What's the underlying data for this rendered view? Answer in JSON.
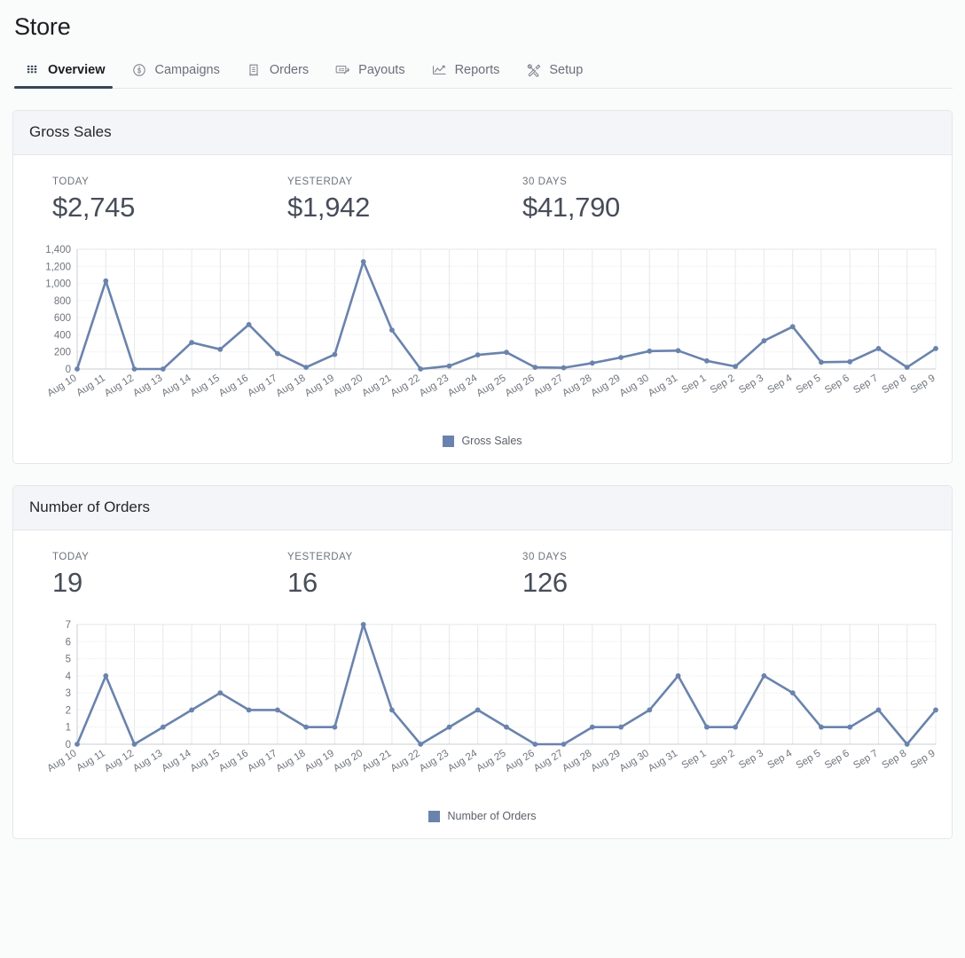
{
  "header": {
    "title": "Store",
    "tabs": [
      {
        "label": "Overview",
        "icon": "grid-dots-icon",
        "active": true
      },
      {
        "label": "Campaigns",
        "icon": "dollar-circle-icon",
        "active": false
      },
      {
        "label": "Orders",
        "icon": "receipt-icon",
        "active": false
      },
      {
        "label": "Payouts",
        "icon": "check-payment-icon",
        "active": false
      },
      {
        "label": "Reports",
        "icon": "line-chart-icon",
        "active": false
      },
      {
        "label": "Setup",
        "icon": "tools-icon",
        "active": false
      }
    ]
  },
  "colors": {
    "series": "#6a83ad",
    "accent": "#3a4457",
    "card_header_bg": "#f3f5f8",
    "border": "#e4e6ea",
    "page_bg": "#fafbfb"
  },
  "cards": [
    {
      "title": "Gross Sales",
      "stats": [
        {
          "label": "TODAY",
          "value": "$2,745"
        },
        {
          "label": "YESTERDAY",
          "value": "$1,942"
        },
        {
          "label": "30 DAYS",
          "value": "$41,790"
        }
      ],
      "legend": "Gross Sales"
    },
    {
      "title": "Number of Orders",
      "stats": [
        {
          "label": "TODAY",
          "value": "19"
        },
        {
          "label": "YESTERDAY",
          "value": "16"
        },
        {
          "label": "30 DAYS",
          "value": "126"
        }
      ],
      "legend": "Number of Orders"
    }
  ],
  "chart_data": [
    {
      "type": "line",
      "title": "Gross Sales",
      "xlabel": "",
      "ylabel": "",
      "grid": true,
      "legend": [
        "Gross Sales"
      ],
      "legend_position": "bottom",
      "ylim": [
        0,
        1400
      ],
      "yticks": [
        0,
        200,
        400,
        600,
        800,
        1000,
        1200,
        1400
      ],
      "ytick_labels": [
        "0",
        "200",
        "400",
        "600",
        "800",
        "1,000",
        "1,200",
        "1,400"
      ],
      "categories": [
        "Aug 10",
        "Aug 11",
        "Aug 12",
        "Aug 13",
        "Aug 14",
        "Aug 15",
        "Aug 16",
        "Aug 17",
        "Aug 18",
        "Aug 19",
        "Aug 20",
        "Aug 21",
        "Aug 22",
        "Aug 23",
        "Aug 24",
        "Aug 25",
        "Aug 26",
        "Aug 27",
        "Aug 28",
        "Aug 29",
        "Aug 30",
        "Aug 31",
        "Sep 1",
        "Sep 2",
        "Sep 3",
        "Sep 4",
        "Sep 5",
        "Sep 6",
        "Sep 7",
        "Sep 8",
        "Sep 9"
      ],
      "series": [
        {
          "name": "Gross Sales",
          "values": [
            0,
            1030,
            0,
            0,
            310,
            230,
            520,
            180,
            20,
            170,
            1255,
            455,
            0,
            35,
            165,
            195,
            20,
            15,
            70,
            135,
            210,
            215,
            95,
            30,
            330,
            495,
            80,
            85,
            240,
            20,
            240
          ]
        }
      ]
    },
    {
      "type": "line",
      "title": "Number of Orders",
      "xlabel": "",
      "ylabel": "",
      "grid": true,
      "legend": [
        "Number of Orders"
      ],
      "legend_position": "bottom",
      "ylim": [
        0,
        7
      ],
      "yticks": [
        0,
        1,
        2,
        3,
        4,
        5,
        6,
        7
      ],
      "ytick_labels": [
        "0",
        "1",
        "2",
        "3",
        "4",
        "5",
        "6",
        "7"
      ],
      "categories": [
        "Aug 10",
        "Aug 11",
        "Aug 12",
        "Aug 13",
        "Aug 14",
        "Aug 15",
        "Aug 16",
        "Aug 17",
        "Aug 18",
        "Aug 19",
        "Aug 20",
        "Aug 21",
        "Aug 22",
        "Aug 23",
        "Aug 24",
        "Aug 25",
        "Aug 26",
        "Aug 27",
        "Aug 28",
        "Aug 29",
        "Aug 30",
        "Aug 31",
        "Sep 1",
        "Sep 2",
        "Sep 3",
        "Sep 4",
        "Sep 5",
        "Sep 6",
        "Sep 7",
        "Sep 8",
        "Sep 9"
      ],
      "series": [
        {
          "name": "Number of Orders",
          "values": [
            0,
            4,
            0,
            1,
            2,
            3,
            2,
            2,
            1,
            1,
            7,
            2,
            0,
            1,
            2,
            1,
            0,
            0,
            1,
            1,
            2,
            4,
            1,
            1,
            4,
            3,
            1,
            1,
            2,
            0,
            2
          ]
        }
      ]
    }
  ]
}
